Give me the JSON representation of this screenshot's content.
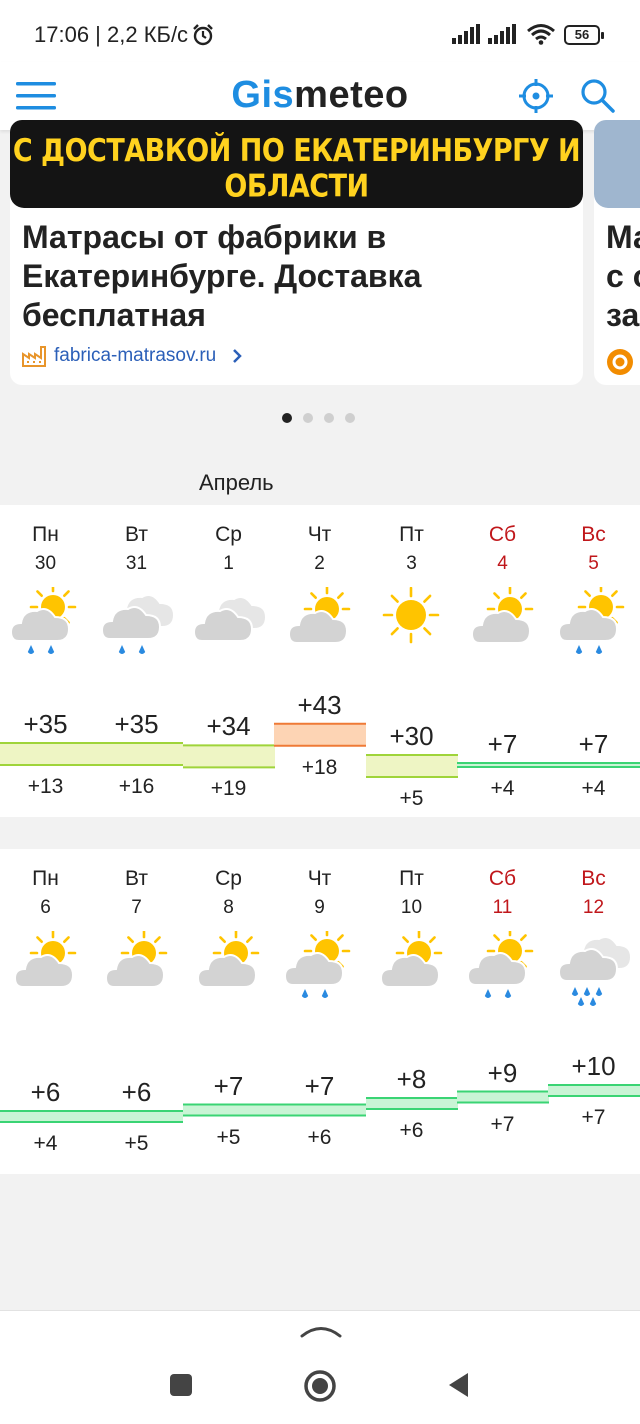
{
  "status_bar": {
    "time": "17:06 | 2,2 КБ/с",
    "battery": "56"
  },
  "app": {
    "logo_part1": "Gis",
    "logo_part2": "meteo"
  },
  "ad": {
    "banner_text": "С ДОСТАВКОЙ ПО ЕКАТЕРИНБУРГУ И ОБЛАСТИ",
    "headline": "Матрасы от фабрики в Екатеринбурге. Доставка бесплатная",
    "source": "fabrica-matrasov.ru",
    "next_card_text": "Ма\nс о\nза"
  },
  "carousel": {
    "dots": 4,
    "active": 0
  },
  "month": "Апрель",
  "weeks": [
    [
      {
        "dow": "Пн",
        "date": "30",
        "high": "+35",
        "low": "+13",
        "icon": "partly-cloudy-rain-icon",
        "weekend": false
      },
      {
        "dow": "Вт",
        "date": "31",
        "high": "+35",
        "low": "+16",
        "icon": "cloudy-rain-icon",
        "weekend": false
      },
      {
        "dow": "Ср",
        "date": "1",
        "high": "+34",
        "low": "+19",
        "icon": "cloudy-icon",
        "weekend": false
      },
      {
        "dow": "Чт",
        "date": "2",
        "high": "+43",
        "low": "+18",
        "icon": "partly-cloudy-icon",
        "weekend": false
      },
      {
        "dow": "Пт",
        "date": "3",
        "high": "+30",
        "low": "+5",
        "icon": "sunny-icon",
        "weekend": false
      },
      {
        "dow": "Сб",
        "date": "4",
        "high": "+7",
        "low": "+4",
        "icon": "partly-cloudy-icon",
        "weekend": true
      },
      {
        "dow": "Вс",
        "date": "5",
        "high": "+7",
        "low": "+4",
        "icon": "partly-cloudy-rain-icon",
        "weekend": true
      }
    ],
    [
      {
        "dow": "Пн",
        "date": "6",
        "high": "+6",
        "low": "+4",
        "icon": "partly-cloudy-icon",
        "weekend": false
      },
      {
        "dow": "Вт",
        "date": "7",
        "high": "+6",
        "low": "+5",
        "icon": "partly-cloudy-icon",
        "weekend": false
      },
      {
        "dow": "Ср",
        "date": "8",
        "high": "+7",
        "low": "+5",
        "icon": "partly-cloudy-icon",
        "weekend": false
      },
      {
        "dow": "Чт",
        "date": "9",
        "high": "+7",
        "low": "+6",
        "icon": "partly-cloudy-rain-icon",
        "weekend": false
      },
      {
        "dow": "Пт",
        "date": "10",
        "high": "+8",
        "low": "+6",
        "icon": "partly-cloudy-icon",
        "weekend": false
      },
      {
        "dow": "Сб",
        "date": "11",
        "high": "+9",
        "low": "+7",
        "icon": "partly-cloudy-rain-icon",
        "weekend": true
      },
      {
        "dow": "Вс",
        "date": "12",
        "high": "+10",
        "low": "+7",
        "icon": "cloudy-heavy-rain-icon",
        "weekend": true
      }
    ]
  ],
  "colors": {
    "brand_blue": "#1e8de1",
    "weekend_red": "#c0171b",
    "sun": "#ffc400",
    "cloud": "#d3d3d3",
    "rain": "#2a8ae0",
    "warm_fill": "#fdd4b4",
    "warm_line": "#ef7a36",
    "mild_fill": "#eef5c4",
    "mild_line": "#9fd43a",
    "cool_fill": "#c9f4d5",
    "cool_line": "#3ad474"
  }
}
